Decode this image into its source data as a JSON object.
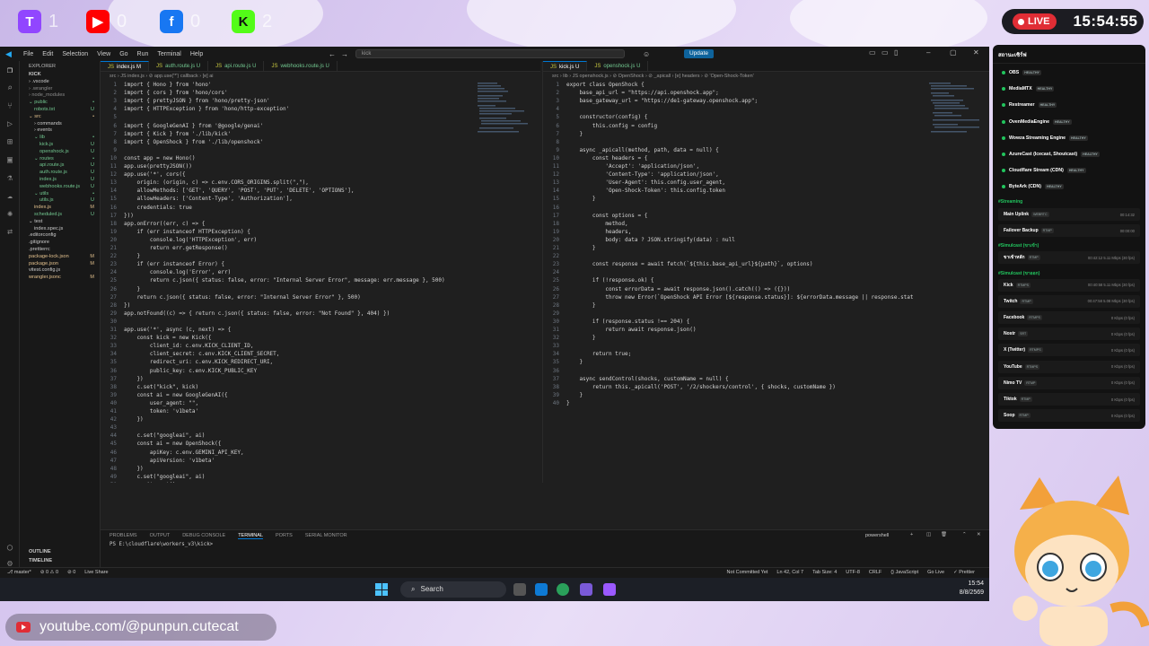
{
  "social": [
    {
      "name": "twitch",
      "count": "1",
      "color": "#9146ff",
      "glyph": "T"
    },
    {
      "name": "youtube",
      "count": "0",
      "color": "#ff0000",
      "glyph": "▶"
    },
    {
      "name": "facebook",
      "count": "0",
      "color": "#1877f2",
      "glyph": "f"
    },
    {
      "name": "kick",
      "count": "2",
      "color": "#53fc18",
      "glyph": "K"
    }
  ],
  "live": {
    "label": "LIVE",
    "time": "15:54:55"
  },
  "vscode": {
    "menu": [
      "File",
      "Edit",
      "Selection",
      "View",
      "Go",
      "Run",
      "Terminal",
      "Help"
    ],
    "search": "kick",
    "update": "Update",
    "explorer": {
      "title": "EXPLORER",
      "root": "KICK",
      "items": [
        {
          "label": "› .vscode",
          "indent": 1,
          "status": "",
          "color": "#ccc"
        },
        {
          "label": "› .wrangler",
          "indent": 1,
          "status": "",
          "color": "#8b8b8b"
        },
        {
          "label": "› node_modules",
          "indent": 1,
          "status": "",
          "color": "#8b8b8b"
        },
        {
          "label": "⌄ public",
          "indent": 1,
          "status": "•",
          "color": "#73c991"
        },
        {
          "label": "robots.txt",
          "indent": 2,
          "status": "U",
          "color": "#73c991"
        },
        {
          "label": "⌄ src",
          "indent": 1,
          "status": "•",
          "color": "#e2c08d"
        },
        {
          "label": "› commands",
          "indent": 2,
          "status": "",
          "color": "#ccc"
        },
        {
          "label": "› events",
          "indent": 2,
          "status": "",
          "color": "#ccc"
        },
        {
          "label": "⌄ lib",
          "indent": 2,
          "status": "•",
          "color": "#73c991"
        },
        {
          "label": "kick.js",
          "indent": 3,
          "status": "U",
          "color": "#73c991"
        },
        {
          "label": "openshock.js",
          "indent": 3,
          "status": "U",
          "color": "#73c991"
        },
        {
          "label": "⌄ routes",
          "indent": 2,
          "status": "•",
          "color": "#73c991"
        },
        {
          "label": "api.route.js",
          "indent": 3,
          "status": "U",
          "color": "#73c991"
        },
        {
          "label": "auth.route.js",
          "indent": 3,
          "status": "U",
          "color": "#73c991"
        },
        {
          "label": "index.js",
          "indent": 3,
          "status": "U",
          "color": "#73c991"
        },
        {
          "label": "webhooks.route.js",
          "indent": 3,
          "status": "U",
          "color": "#73c991"
        },
        {
          "label": "⌄ utils",
          "indent": 2,
          "status": "•",
          "color": "#73c991"
        },
        {
          "label": "utils.js",
          "indent": 3,
          "status": "U",
          "color": "#73c991"
        },
        {
          "label": "index.js",
          "indent": 2,
          "status": "M",
          "color": "#e2c08d"
        },
        {
          "label": "scheduled.js",
          "indent": 2,
          "status": "U",
          "color": "#73c991"
        },
        {
          "label": "⌄ test",
          "indent": 1,
          "status": "",
          "color": "#ccc"
        },
        {
          "label": "index.spec.js",
          "indent": 2,
          "status": "",
          "color": "#ccc"
        },
        {
          "label": ".editorconfig",
          "indent": 1,
          "status": "",
          "color": "#ccc"
        },
        {
          "label": ".gitignore",
          "indent": 1,
          "status": "",
          "color": "#ccc"
        },
        {
          "label": ".prettierrc",
          "indent": 1,
          "status": "",
          "color": "#ccc"
        },
        {
          "label": "package-lock.json",
          "indent": 1,
          "status": "M",
          "color": "#e2c08d"
        },
        {
          "label": "package.json",
          "indent": 1,
          "status": "M",
          "color": "#e2c08d"
        },
        {
          "label": "vitest.config.js",
          "indent": 1,
          "status": "",
          "color": "#ccc"
        },
        {
          "label": "wrangler.jsonc",
          "indent": 1,
          "status": "M",
          "color": "#e2c08d"
        }
      ],
      "outline": "OUTLINE",
      "timeline": "TIMELINE"
    },
    "left_tabs": [
      "index.js M",
      "auth.route.js U",
      "api.route.js U",
      "webhooks.route.js U"
    ],
    "left_breadcrumb": "src › JS index.js › ⊘ app.use('*') callback › [e] ai",
    "left_code": [
      "import { Hono } from 'hono'",
      "import { cors } from 'hono/cors'",
      "import { prettyJSON } from 'hono/pretty-json'",
      "import { HTTPException } from 'hono/http-exception'",
      "",
      "import { GoogleGenAI } from '@google/genai'",
      "import { Kick } from './lib/kick'",
      "import { OpenShock } from './lib/openshock'",
      "",
      "const app = new Hono()",
      "app.use(prettyJSON())",
      "app.use('*', cors({",
      "    origin: (origin, c) => c.env.CORS_ORIGINS.split(\",\"),",
      "    allowMethods: ['GET', 'QUERY', 'POST', 'PUT', 'DELETE', 'OPTIONS'],",
      "    allowHeaders: ['Content-Type', 'Authorization'],",
      "    credentials: true",
      "}))",
      "app.onError((err, c) => {",
      "    if (err instanceof HTTPException) {",
      "        console.log('HTTPException', err)",
      "        return err.getResponse()",
      "    }",
      "    if (err instanceof Error) {",
      "        console.log('Error', err)",
      "        return c.json({ status: false, error: \"Internal Server Error\", message: err.message }, 500)",
      "    }",
      "    return c.json({ status: false, error: \"Internal Server Error\" }, 500)",
      "})",
      "app.notFound((c) => { return c.json({ status: false, error: \"Not Found\" }, 404) })",
      "",
      "app.use('*', async (c, next) => {",
      "    const kick = new Kick({",
      "        client_id: c.env.KICK_CLIENT_ID,",
      "        client_secret: c.env.KICK_CLIENT_SECRET,",
      "        redirect_uri: c.env.KICK_REDIRECT_URI,",
      "        public_key: c.env.KICK_PUBLIC_KEY",
      "    })",
      "    c.set(\"kick\", kick)",
      "    const ai = new GoogleGenAI({",
      "        user_agent: \"\",",
      "        token: 'v1beta'",
      "    })",
      "",
      "    c.set(\"googleai\", ai)",
      "    const ai = new OpenShock({",
      "        apiKey: c.env.GEMINI_API_KEY,",
      "        apiVersion: 'v1beta'",
      "    })",
      "    c.set(\"googleai\", ai)",
      "    await next()",
      "})",
      "",
      "import routes from './routes'",
      "app.route('/', routes)"
    ],
    "right_tabs": [
      "kick.js U",
      "openshock.js U"
    ],
    "right_breadcrumb": "src › lib › JS openshock.js › ⊘ OpenShock › ⊘ _apicall › [e] headers › ⊘ 'Open-Shock-Token'",
    "right_code": [
      "export class OpenShock {",
      "    base_api_url = \"https://api.openshock.app\";",
      "    base_gateway_url = \"https://de1-gateway.openshock.app\";",
      "",
      "    constructor(config) {",
      "        this.config = config",
      "    }",
      "",
      "    async _apicall(method, path, data = null) {",
      "        const headers = {",
      "            'Accept': 'application/json',",
      "            'Content-Type': 'application/json',",
      "            'User-Agent': this.config.user_agent,",
      "            'Open-Shock-Token': this.config.token",
      "        }",
      "",
      "        const options = {",
      "            method,",
      "            headers,",
      "            body: data ? JSON.stringify(data) : null",
      "        }",
      "",
      "        const response = await fetch(`${this.base_api_url}${path}`, options)",
      "",
      "        if (!response.ok) {",
      "            const errorData = await response.json().catch(() => ({}))",
      "            throw new Error(`OpenShock API Error [${response.status}]: ${errorData.message || response.stat",
      "        }",
      "",
      "        if (response.status !== 204) {",
      "            return await response.json()",
      "        }",
      "",
      "        return true;",
      "    }",
      "",
      "    async sendControl(shocks, customName = null) {",
      "        return this._apicall('POST', '/2/shockers/control', { shocks, customName })",
      "    }",
      "}"
    ],
    "panel_tabs": [
      "PROBLEMS",
      "OUTPUT",
      "DEBUG CONSOLE",
      "TERMINAL",
      "PORTS",
      "SERIAL MONITOR"
    ],
    "terminal_shell": "powershell",
    "terminal_prompt": "PS E:\\cloudflare\\workers_v3\\kick>",
    "status_left": [
      "⎇ master*",
      "⊘ 0 ⚠ 0",
      "⊘ 0",
      "Live Share"
    ],
    "status_right": [
      "Not Committed Yet",
      "Ln 42, Col 7",
      "Tab Size: 4",
      "UTF-8",
      "CRLF",
      "{} JavaScript",
      "Go Live",
      "✓ Prettier"
    ]
  },
  "taskbar": {
    "search": "Search",
    "time": "15:54",
    "date": "8/8/2569"
  },
  "status_panel": {
    "title": "สถานะเซิร์ฟ",
    "servers": [
      "OBS",
      "MediaMTX",
      "Restreamer",
      "OvenMediaEngine",
      "Wowza Streaming Engine",
      "AzureCast (Icecast, Shoutcast)",
      "Cloudflare Stream (CDN)",
      "ByteArk (CDN)"
    ],
    "health": "HEALTHY",
    "streaming_label": "#Streaming",
    "streaming": [
      {
        "name": "Main Uplink",
        "tag": "WEBRTC",
        "rate": "00:14:32"
      },
      {
        "name": "Failover Backup",
        "tag": "RTMP",
        "rate": "00:00:00"
      }
    ],
    "simulcast_label1": "#Simulcast (ขาเข้า)",
    "simulcast_in": [
      {
        "name": "ขาเข้าหลัก",
        "tag": "RTMP",
        "rate": "00:42:12   5.11 Mbps   (30 fps)"
      }
    ],
    "simulcast_label2": "#Simulcast (ขาออก)",
    "simulcast_out": [
      {
        "name": "Kick",
        "tag": "RTMPS",
        "rate": "00:40:58   5.11 Mbps   (30 fps)"
      },
      {
        "name": "Twitch",
        "tag": "RTMP",
        "rate": "00:47:58   5.08 Mbps   (30 fps)"
      },
      {
        "name": "Facebook",
        "tag": "RTMPS",
        "rate": "0 Kbps   (0 fps)"
      },
      {
        "name": "Nostr",
        "tag": "SRT",
        "rate": "0 Kbps   (0 fps)"
      },
      {
        "name": "X (Twitter)",
        "tag": "RTMPS",
        "rate": "0 Kbps   (0 fps)"
      },
      {
        "name": "YouTube",
        "tag": "RTMPS",
        "rate": "0 Kbps   (0 fps)"
      },
      {
        "name": "Nimo TV",
        "tag": "RTMP",
        "rate": "0 Kbps   (0 fps)"
      },
      {
        "name": "Tiktok",
        "tag": "RTMP",
        "rate": "0 Kbps   (0 fps)"
      },
      {
        "name": "Soop",
        "tag": "RTMP",
        "rate": "0 Kbps   (0 fps)"
      }
    ]
  },
  "footer": {
    "url": "youtube.com/@punpun.cutecat"
  }
}
